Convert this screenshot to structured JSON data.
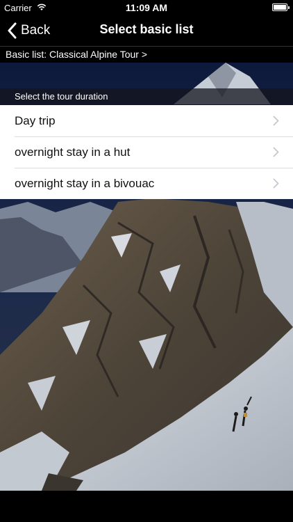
{
  "status": {
    "carrier": "Carrier",
    "time": "11:09 AM"
  },
  "nav": {
    "back_label": "Back",
    "title": "Select basic list"
  },
  "breadcrumb": "Basic list: Classical Alpine Tour >",
  "section_header": "Select the tour duration",
  "rows": [
    {
      "label": "Day trip"
    },
    {
      "label": "overnight stay in a hut"
    },
    {
      "label": "overnight stay in a bivouac"
    }
  ],
  "icons": {
    "back": "chevron-left-icon",
    "row": "chevron-right-icon",
    "wifi": "wifi-icon",
    "battery": "battery-icon"
  }
}
